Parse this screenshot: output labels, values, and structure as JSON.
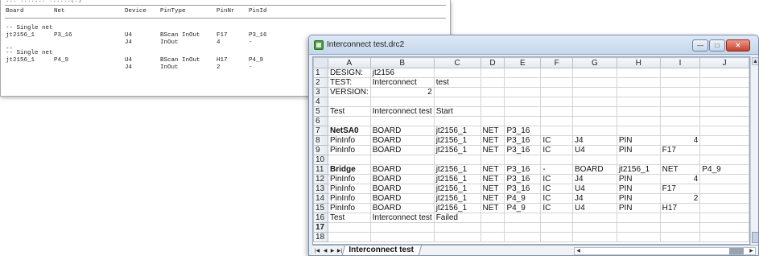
{
  "report": {
    "clipped_header": "... ....... ......(.)",
    "headers": [
      "Board",
      "Net",
      "Device",
      "PinType",
      "PinNr",
      "PinId"
    ],
    "groups": [
      {
        "comment1": "-- Single net",
        "board": "jt2156_1",
        "net": "P3_16",
        "rows": [
          {
            "device": "U4",
            "pintype": "BScan InOut",
            "pinnr": "F17",
            "pinid": "P3_16"
          },
          {
            "device": "J4",
            "pintype": "InOut",
            "pinnr": "4",
            "pinid": "-"
          }
        ],
        "comment2": "--"
      },
      {
        "comment1": "-- Single net",
        "board": "jt2156_1",
        "net": "P4_9",
        "rows": [
          {
            "device": "U4",
            "pintype": "BScan InOut",
            "pinnr": "H17",
            "pinid": "P4_9"
          },
          {
            "device": "J4",
            "pintype": "InOut",
            "pinnr": "2",
            "pinid": "-"
          }
        ]
      }
    ]
  },
  "spreadsheet": {
    "title": "Interconnect test.drc2",
    "columns": [
      "A",
      "B",
      "C",
      "D",
      "E",
      "F",
      "G",
      "H",
      "I",
      "J"
    ],
    "rows": [
      {
        "n": "1",
        "cells": [
          "DESIGN:",
          "jt2156",
          "",
          "",
          "",
          "",
          "",
          "",
          "",
          ""
        ]
      },
      {
        "n": "2",
        "cells": [
          "TEST:",
          "Interconnect",
          "test",
          "",
          "",
          "",
          "",
          "",
          "",
          ""
        ]
      },
      {
        "n": "3",
        "cells": [
          "VERSION:",
          "2",
          "",
          "",
          "",
          "",
          "",
          "",
          "",
          ""
        ],
        "num": [
          1
        ]
      },
      {
        "n": "4",
        "cells": [
          "",
          "",
          "",
          "",
          "",
          "",
          "",
          "",
          "",
          ""
        ]
      },
      {
        "n": "5",
        "cells": [
          "Test",
          "Interconnect test",
          "Start",
          "",
          "",
          "",
          "",
          "",
          "",
          ""
        ]
      },
      {
        "n": "6",
        "cells": [
          "",
          "",
          "",
          "",
          "",
          "",
          "",
          "",
          "",
          ""
        ]
      },
      {
        "n": "7",
        "cells": [
          "NetSA0",
          "BOARD",
          "jt2156_1",
          "NET",
          "P3_16",
          "",
          "",
          "",
          "",
          ""
        ],
        "bold": [
          0
        ]
      },
      {
        "n": "8",
        "cells": [
          "PinInfo",
          "BOARD",
          "jt2156_1",
          "NET",
          "P3_16",
          "IC",
          "J4",
          "PIN",
          "4",
          ""
        ],
        "num": [
          8
        ]
      },
      {
        "n": "9",
        "cells": [
          "PinInfo",
          "BOARD",
          "jt2156_1",
          "NET",
          "P3_16",
          "IC",
          "U4",
          "PIN",
          "F17",
          ""
        ]
      },
      {
        "n": "10",
        "cells": [
          "",
          "",
          "",
          "",
          "",
          "",
          "",
          "",
          "",
          ""
        ]
      },
      {
        "n": "11",
        "cells": [
          "Bridge",
          "BOARD",
          "jt2156_1",
          "NET",
          "P3_16",
          "-",
          "BOARD",
          "jt2156_1",
          "NET",
          "P4_9"
        ],
        "bold": [
          0
        ]
      },
      {
        "n": "12",
        "cells": [
          "PinInfo",
          "BOARD",
          "jt2156_1",
          "NET",
          "P3_16",
          "IC",
          "J4",
          "PIN",
          "4",
          ""
        ],
        "num": [
          8
        ]
      },
      {
        "n": "13",
        "cells": [
          "PinInfo",
          "BOARD",
          "jt2156_1",
          "NET",
          "P3_16",
          "IC",
          "U4",
          "PIN",
          "F17",
          ""
        ]
      },
      {
        "n": "14",
        "cells": [
          "PinInfo",
          "BOARD",
          "jt2156_1",
          "NET",
          "P4_9",
          "IC",
          "J4",
          "PIN",
          "2",
          ""
        ],
        "num": [
          8
        ]
      },
      {
        "n": "15",
        "cells": [
          "PinInfo",
          "BOARD",
          "jt2156_1",
          "NET",
          "P4_9",
          "IC",
          "U4",
          "PIN",
          "H17",
          ""
        ]
      },
      {
        "n": "16",
        "cells": [
          "Test",
          "Interconnect test",
          "Failed",
          "",
          "",
          "",
          "",
          "",
          "",
          ""
        ]
      },
      {
        "n": "17",
        "cells": [
          "",
          "",
          "",
          "",
          "",
          "",
          "",
          "",
          "",
          ""
        ],
        "selected": true
      },
      {
        "n": "18",
        "cells": [
          "",
          "",
          "",
          "",
          "",
          "",
          "",
          "",
          "",
          ""
        ]
      }
    ],
    "sheet_tab": "Interconnect test"
  }
}
